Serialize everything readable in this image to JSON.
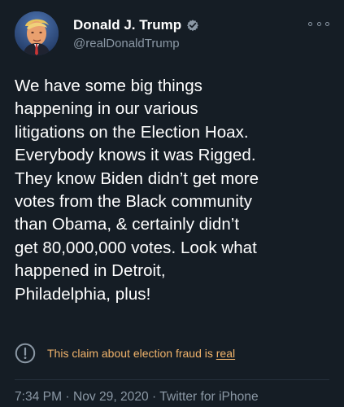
{
  "tweet": {
    "author": {
      "display_name": "Donald J. Trump",
      "handle": "@realDonaldTrump",
      "avatar_icon": "profile-photo",
      "verified_icon": "verified-badge-icon"
    },
    "menu": {
      "icon": "more-options-icon"
    },
    "text_lines": [
      "We have some big things",
      "happening in our various",
      "litigations on the Election Hoax.",
      "Everybody knows it was Rigged.",
      "They know Biden didn’t get more",
      "votes from the Black community",
      "than Obama, & certainly didn’t",
      "get 80,000,000 votes. Look what",
      "happened in Detroit,",
      "Philadelphia, plus!"
    ],
    "notice": {
      "icon": "warning-icon",
      "prefix": "This claim about election fraud is ",
      "link": "real"
    },
    "meta": {
      "time": "7:34 PM",
      "separator_1": " · ",
      "date": "Nov 29, 2020",
      "separator_2": " · ",
      "source": "Twitter for iPhone"
    }
  },
  "colors": {
    "background": "#151d25",
    "text": "#ffffff",
    "muted": "#8b98a5",
    "notice": "#f0b36b",
    "verified": "#8b98a5"
  }
}
